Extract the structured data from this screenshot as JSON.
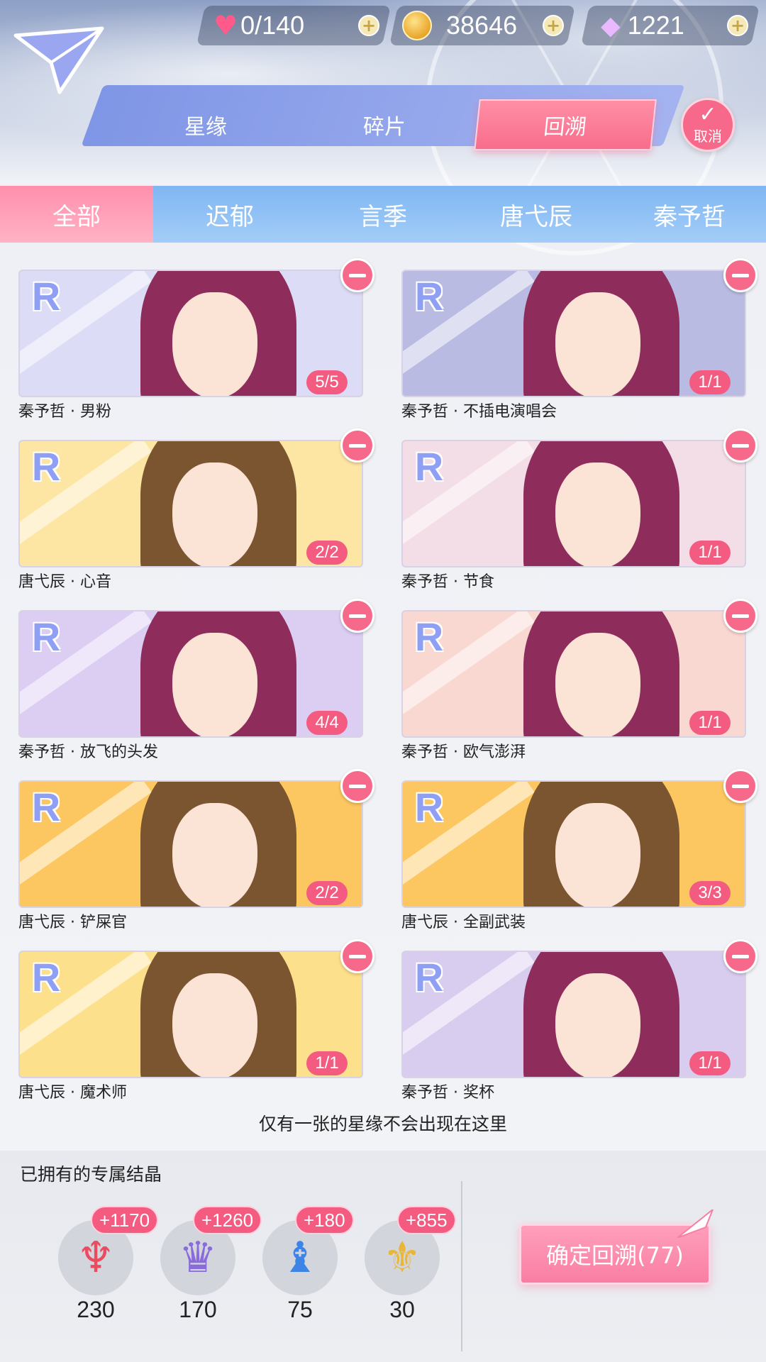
{
  "resources": {
    "stamina": "0/140",
    "gold": "38646",
    "diamonds": "1221"
  },
  "tabs": {
    "items": [
      "星缘",
      "碎片",
      "回溯"
    ],
    "active": "回溯",
    "cancel_label": "取消"
  },
  "filters": {
    "items": [
      "全部",
      "迟郁",
      "言季",
      "唐弋辰",
      "秦予哲"
    ],
    "active": "全部"
  },
  "cards": [
    {
      "name": "秦予哲 · 男粉",
      "count": "5/5",
      "rarity": "R",
      "bg": "#dcdcf6",
      "hair": "#8e2c5c"
    },
    {
      "name": "秦予哲 · 不插电演唱会",
      "count": "1/1",
      "rarity": "R",
      "bg": "#b9bbe3",
      "hair": "#8e2c5c"
    },
    {
      "name": "唐弋辰 · 心音",
      "count": "2/2",
      "rarity": "R",
      "bg": "#fde5a3",
      "hair": "#7a5530"
    },
    {
      "name": "秦予哲 · 节食",
      "count": "1/1",
      "rarity": "R",
      "bg": "#f3dde6",
      "hair": "#8e2c5c"
    },
    {
      "name": "秦予哲 · 放飞的头发",
      "count": "4/4",
      "rarity": "R",
      "bg": "#dccdf3",
      "hair": "#8e2c5c"
    },
    {
      "name": "秦予哲 · 欧气澎湃",
      "count": "1/1",
      "rarity": "R",
      "bg": "#f9d8d2",
      "hair": "#8e2c5c"
    },
    {
      "name": "唐弋辰 · 铲屎官",
      "count": "2/2",
      "rarity": "R",
      "bg": "#fcc760",
      "hair": "#7a5530"
    },
    {
      "name": "唐弋辰 · 全副武装",
      "count": "3/3",
      "rarity": "R",
      "bg": "#fcc760",
      "hair": "#7a5530"
    },
    {
      "name": "唐弋辰 · 魔术师",
      "count": "1/1",
      "rarity": "R",
      "bg": "#fde08c",
      "hair": "#7a5530"
    },
    {
      "name": "秦予哲 · 奖杯",
      "count": "1/1",
      "rarity": "R",
      "bg": "#d9cdef",
      "hair": "#8e2c5c"
    }
  ],
  "note": "仅有一张的星缘不会出现在这里",
  "crystals": {
    "title": "已拥有的专属结晶",
    "items": [
      {
        "bonus": "+1170",
        "owned": "230",
        "icon": "red-crystal-icon",
        "color": "#ec4b5f"
      },
      {
        "bonus": "+1260",
        "owned": "170",
        "icon": "purple-crystal-icon",
        "color": "#8a6bdc"
      },
      {
        "bonus": "+180",
        "owned": "75",
        "icon": "blue-crystal-icon",
        "color": "#3d84e6"
      },
      {
        "bonus": "+855",
        "owned": "30",
        "icon": "gold-crystal-icon",
        "color": "#e8b737"
      }
    ]
  },
  "confirm_label": "确定回溯(77)"
}
